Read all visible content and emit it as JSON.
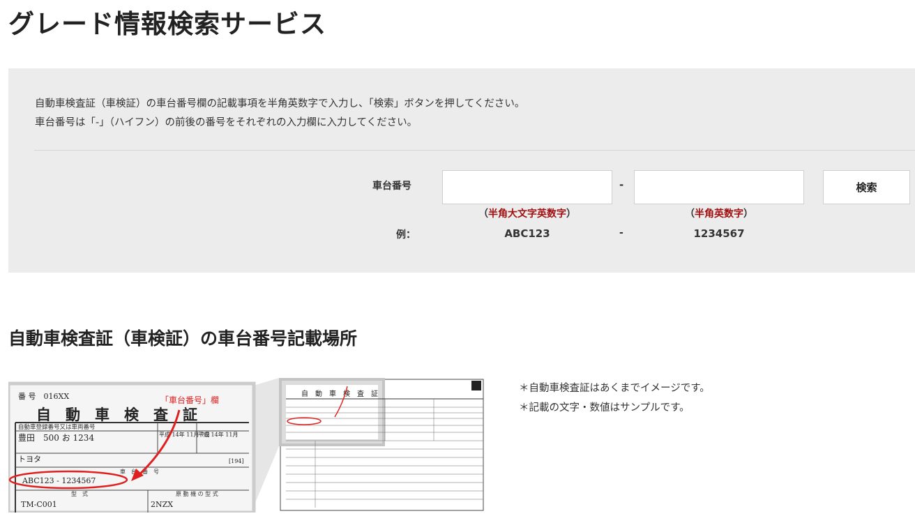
{
  "page_title": "グレード情報検索サービス",
  "instructions": {
    "line1": "自動車検査証（車検証）の車台番号欄の記載事項を半角英数字で入力し、「検索」ボタンを押してください。",
    "line2": "車台番号は「-」（ハイフン）の前後の番号をそれぞれの入力欄に入力してください。"
  },
  "form": {
    "field_label": "車台番号",
    "input1_value": "",
    "input2_value": "",
    "separator": "-",
    "search_button": "検索",
    "hint1": {
      "open": "（",
      "text": "半角大文字英数字",
      "close": "）"
    },
    "hint2": {
      "open": "（",
      "text": "半角英数字",
      "close": "）"
    },
    "example_label": "例：",
    "example1": "ABC123",
    "example_separator": "-",
    "example2": "1234567"
  },
  "section_heading": "自動車検査証（車検証）の車台番号記載場所",
  "illustration": {
    "callout": "「車台番号」欄",
    "zoom_serial": "番 号　016XX",
    "zoom_title": "自　動　車　検　査　証",
    "zoom_reg_header": "自動車登録番号又は車両番号",
    "zoom_plate": "豊田　500 お 1234",
    "zoom_date1": "平成\n14年 11月 7日",
    "zoom_date2": "平成\n14年 11月",
    "zoom_maker": "トヨタ",
    "zoom_code": "[194]",
    "zoom_chassis_header": "車　台　番　号",
    "zoom_chassis_number": "ABC123 - 1234567",
    "zoom_type_header": "型　式",
    "zoom_engine_header": "原 動 機 の 型 式",
    "zoom_type_value": "TM-C001",
    "zoom_engine_value": "2NZX",
    "mini_title": "自　動　車　検　査　証"
  },
  "notes": {
    "line1": "＊自動車検査証はあくまでイメージです。",
    "line2": "＊記載の文字・数値はサンプルです。"
  },
  "colors": {
    "panel_background": "#ececec",
    "hint_red": "#a01010",
    "callout_red": "#e02020"
  }
}
